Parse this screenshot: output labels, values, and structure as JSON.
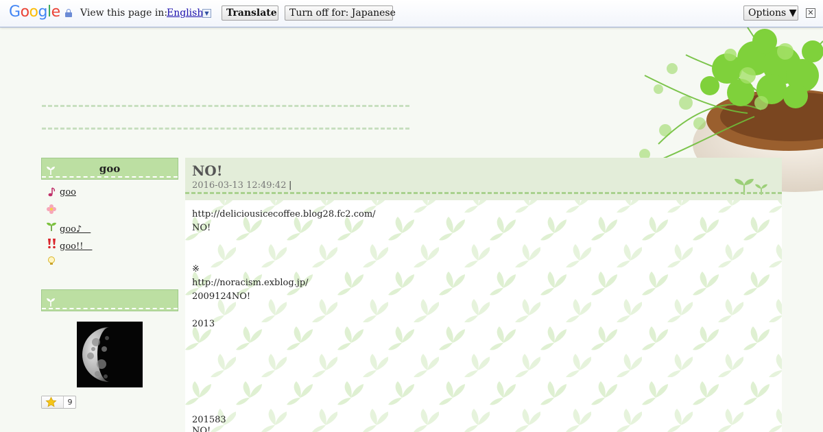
{
  "translate_bar": {
    "logo": [
      "G",
      "o",
      "o",
      "g",
      "l",
      "e"
    ],
    "logo_colors": [
      "#4285f4",
      "#ea4335",
      "#fbbc05",
      "#4285f4",
      "#34a853",
      "#ea4335"
    ],
    "view_label": "View this page in:",
    "language": "English",
    "dropdown_glyph": "▼",
    "translate_label": "Translate",
    "turn_off_label": "Turn off for: Japanese",
    "options_label": "Options ▼",
    "close_glyph": "✕"
  },
  "sidebar": {
    "section1_title": "goo",
    "items": [
      {
        "icon": "music-note-icon",
        "label": "goo"
      },
      {
        "icon": "flower-icon",
        "label": ""
      },
      {
        "icon": "sprout-icon",
        "label": "goo♪　"
      },
      {
        "icon": "double-exclamation-icon",
        "label": "goo!!　"
      },
      {
        "icon": "lightbulb-icon",
        "label": ""
      }
    ],
    "section2_title": "",
    "star_count": "9"
  },
  "entry": {
    "title": "NO!",
    "date": "2016-03-13 12:49:42",
    "separator": "|",
    "lines": [
      "http://deliciousicecoffee.blog28.fc2.com/",
      "NO!",
      "",
      "",
      "※",
      "http://noracism.exblog.jp/",
      "2009124NO!",
      "",
      "2013",
      "",
      "",
      "",
      "",
      "",
      "",
      "201583",
      "NO!"
    ]
  },
  "colors": {
    "sidebar_header": "#bcdfa2",
    "entry_header": "#e3edd9",
    "leaf": "#d8ecc9"
  }
}
